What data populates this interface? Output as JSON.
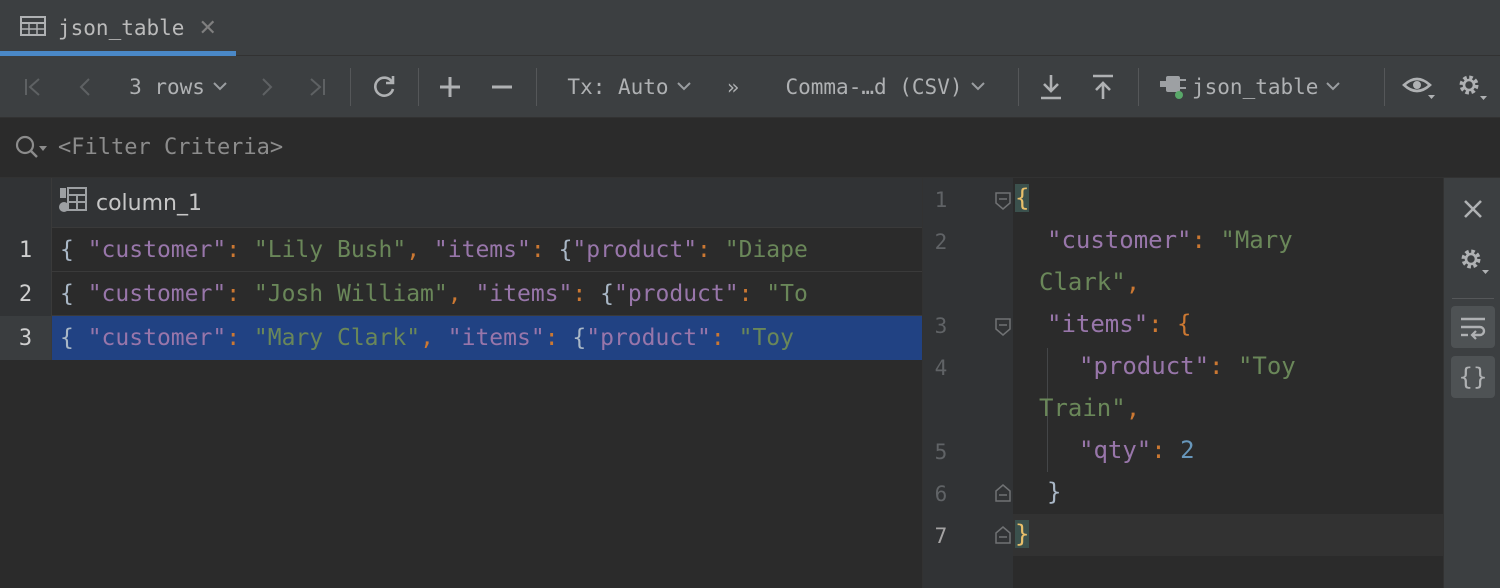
{
  "tab": {
    "label": "json_table"
  },
  "toolbar": {
    "rows_label": "3 rows",
    "tx_label": "Tx: Auto",
    "more_label": "»",
    "format_label": "Comma-…d (CSV)",
    "datasource_label": "json_table"
  },
  "filter": {
    "placeholder": "<Filter Criteria>"
  },
  "grid": {
    "column_header": "column_1",
    "rows": [
      {
        "num": "1",
        "text": "{ \"customer\": \"Lily Bush\", \"items\": {\"product\": \"Diape"
      },
      {
        "num": "2",
        "text": "{ \"customer\": \"Josh William\", \"items\": {\"product\": \"To"
      },
      {
        "num": "3",
        "text": "{ \"customer\": \"Mary Clark\", \"items\": {\"product\": \"Toy "
      }
    ],
    "selected_row": 3
  },
  "editor": {
    "line_numbers": [
      "1",
      "2",
      "3",
      "4",
      "5",
      "6",
      "7"
    ],
    "lines": {
      "l1": "{",
      "l2a": "\"customer\"",
      "l2b": ": ",
      "l2c": "\"Mary",
      "l2d": "Clark\"",
      "l2e": ",",
      "l3a": "\"items\"",
      "l3b": ": {",
      "l4a": "\"product\"",
      "l4b": ": ",
      "l4c": "\"Toy",
      "l4d": "Train\"",
      "l4e": ",",
      "l5a": "\"qty\"",
      "l5b": ": ",
      "l5c": "2",
      "l6": "}",
      "l7": "}"
    }
  },
  "colors": {
    "selection": "#214283",
    "key": "#9876aa",
    "string": "#6a8759",
    "punct": "#cc7832",
    "number": "#6897bb",
    "brace_match": "#e8bf6a",
    "accent": "#4a88c7"
  },
  "icons": [
    "table-icon",
    "close-icon",
    "first-page-icon",
    "prev-page-icon",
    "next-page-icon",
    "last-page-icon",
    "refresh-icon",
    "add-row-icon",
    "remove-row-icon",
    "download-icon",
    "upload-icon",
    "datasource-icon",
    "eye-icon",
    "gear-icon",
    "search-icon",
    "column-icon",
    "soft-wrap-icon",
    "braces-icon"
  ]
}
